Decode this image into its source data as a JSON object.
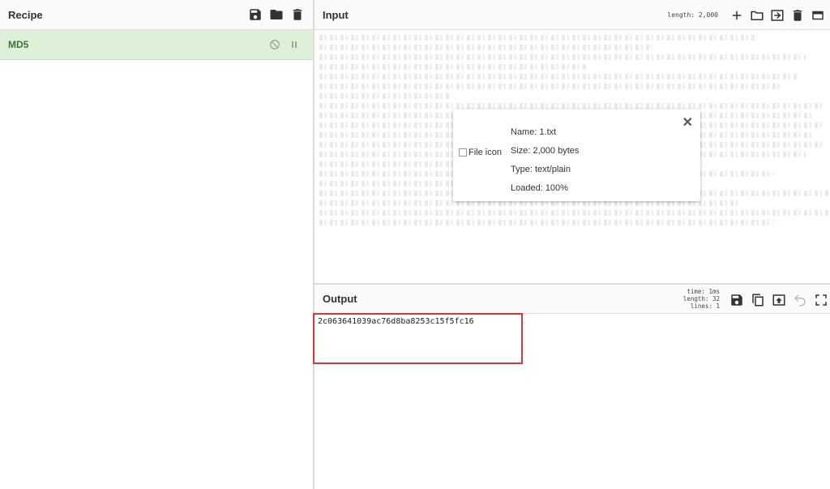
{
  "recipe": {
    "title": "Recipe",
    "operations": [
      {
        "name": "MD5"
      }
    ]
  },
  "input": {
    "title": "Input",
    "length_label": "length: 2,000"
  },
  "file_details": {
    "icon_alt": "File icon",
    "name": "Name: 1.txt",
    "size": "Size: 2,000 bytes",
    "type": "Type: text/plain",
    "loaded": "Loaded: 100%",
    "loaded_fraction": 1.0
  },
  "output": {
    "title": "Output",
    "stats": {
      "time": "time:  1ms",
      "length": "length:  32",
      "lines": "lines:   1"
    },
    "value": "2c063641039ac76d8ba8253c15f5fc16"
  },
  "icons": {
    "recipe_header": [
      "save-icon",
      "folder-icon",
      "trash-icon"
    ],
    "operation_controls": [
      "disable-icon",
      "pause-icon"
    ],
    "input_header": [
      "plus-icon",
      "folder-icon",
      "import-icon",
      "trash-icon",
      "layout-icon"
    ],
    "output_header": [
      "save-icon",
      "copy-icon",
      "move-to-input-icon",
      "undo-icon",
      "maximise-icon"
    ]
  },
  "colors": {
    "operation_bg": "#dff0d8",
    "operation_text": "#3c763d",
    "highlight_border": "#d9363e"
  }
}
